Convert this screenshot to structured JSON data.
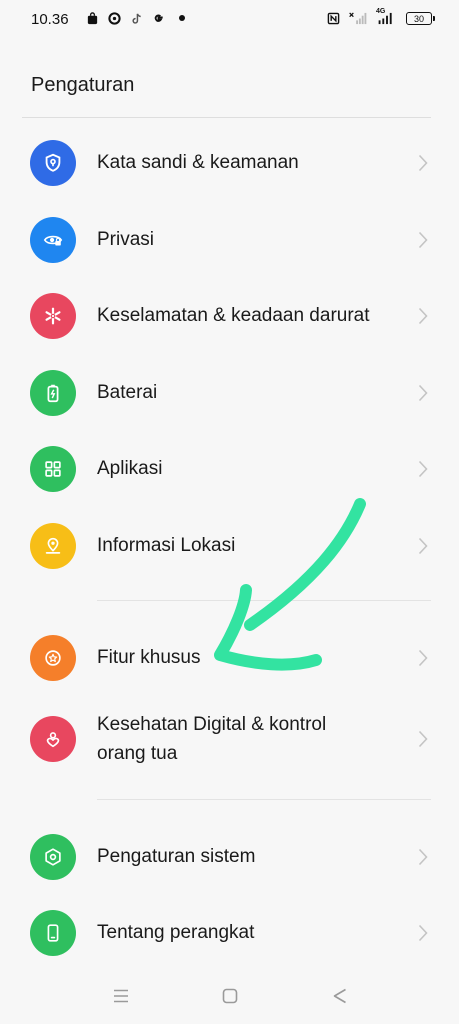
{
  "status_bar": {
    "time": "10.36",
    "notification_icons": [
      "shopping-bag-icon",
      "circle-app-icon",
      "tiktok-icon",
      "google-icon"
    ],
    "right_icons": [
      "nfc-icon",
      "signal-x-icon",
      "volte-signal-icon"
    ],
    "network_label": "4G",
    "battery": "30"
  },
  "header": {
    "title": "Pengaturan"
  },
  "colors": {
    "blue": "#2f6be6",
    "blue_privacy": "#1f86f0",
    "red": "#e8475f",
    "green": "#2fbf5f",
    "yellow": "#f7be17",
    "orange": "#f57f2a",
    "arrow": "#33e3a1"
  },
  "settings": [
    {
      "label": "Kata sandi & keamanan",
      "icon": "shield-key-icon",
      "color": "#2f6be6"
    },
    {
      "label": "Privasi",
      "icon": "eye-lock-icon",
      "color": "#1f86f0"
    },
    {
      "label": "Keselamatan & keadaan darurat",
      "icon": "asterisk-icon",
      "color": "#e8475f"
    },
    {
      "label": "Baterai",
      "icon": "battery-icon",
      "color": "#2fbf5f"
    },
    {
      "label": "Aplikasi",
      "icon": "apps-grid-icon",
      "color": "#2fbf5f"
    },
    {
      "label": "Informasi Lokasi",
      "icon": "location-pin-icon",
      "color": "#f7be17"
    },
    {
      "label": "Fitur khusus",
      "icon": "star-circle-icon",
      "color": "#f57f2a"
    },
    {
      "label_line1": "Kesehatan Digital & kontrol",
      "label_line2": "orang tua",
      "icon": "heart-person-icon",
      "color": "#e8475f"
    },
    {
      "label": "Pengaturan sistem",
      "icon": "hexagon-gear-icon",
      "color": "#2fbf5f"
    },
    {
      "label": "Tentang perangkat",
      "icon": "phone-icon",
      "color": "#2fbf5f"
    }
  ],
  "nav_bar": [
    "menu-icon",
    "home-square-icon",
    "back-triangle-icon"
  ]
}
